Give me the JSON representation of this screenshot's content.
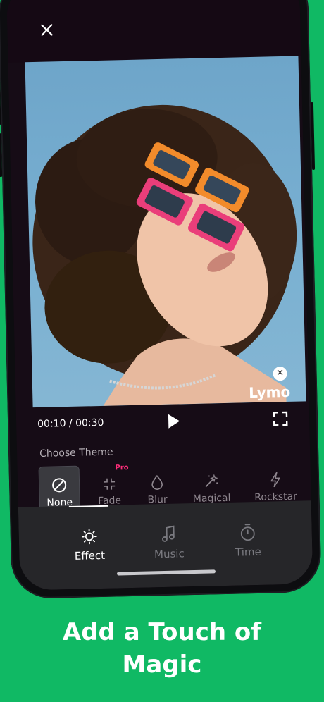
{
  "app": {
    "close_icon": "close-icon",
    "watermark": "Lymo",
    "time_display": "00:10 / 00:30",
    "choose_theme_label": "Choose Theme",
    "themes": [
      {
        "label": "None",
        "icon": "no-effect-icon",
        "selected": true
      },
      {
        "label": "Fade",
        "icon": "fade-icon",
        "badge": "Pro"
      },
      {
        "label": "Blur",
        "icon": "droplet-icon"
      },
      {
        "label": "Magical",
        "icon": "magic-wand-icon"
      },
      {
        "label": "Rockstar",
        "icon": "lightning-icon"
      }
    ],
    "tabs": [
      {
        "label": "Effect",
        "icon": "sun-icon",
        "active": true
      },
      {
        "label": "Music",
        "icon": "music-note-icon"
      },
      {
        "label": "Time",
        "icon": "stopwatch-icon"
      }
    ]
  },
  "promo": {
    "headline_line1": "Add a Touch of",
    "headline_line2": "Magic"
  },
  "colors": {
    "background": "#10b964",
    "pro_badge": "#ff2d7a",
    "screen_bg": "#160c16",
    "tabbar_bg": "#262629"
  }
}
